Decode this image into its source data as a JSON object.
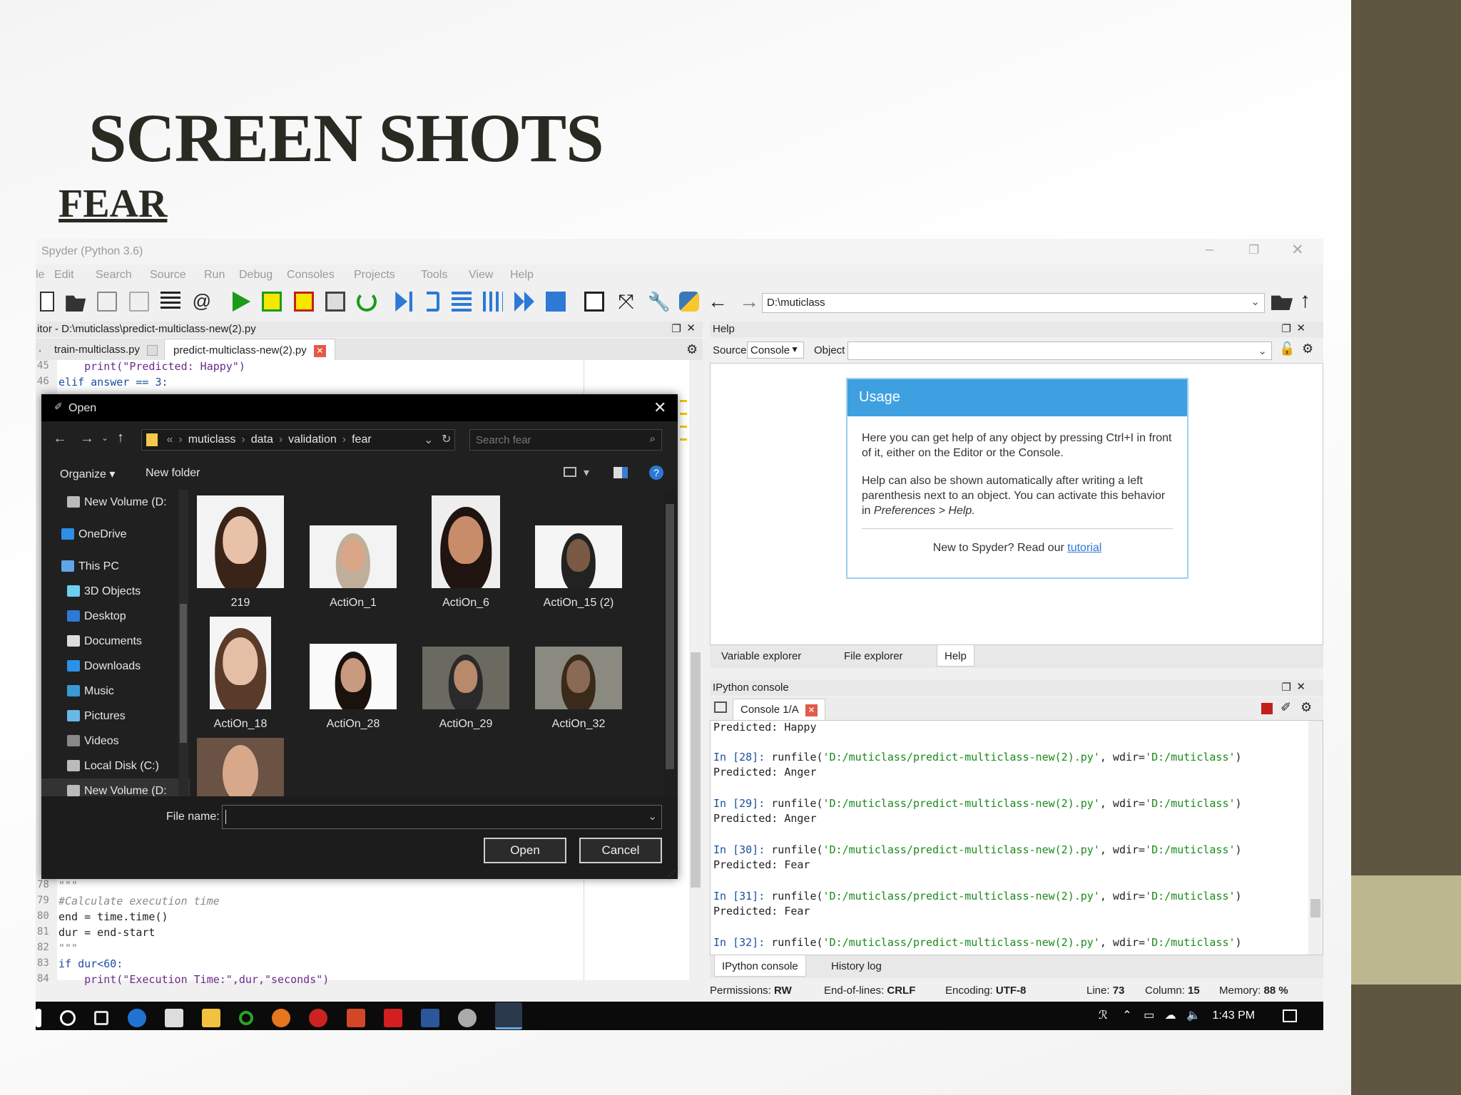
{
  "slide": {
    "title": "SCREEN SHOTS",
    "subtitle": "FEAR"
  },
  "window": {
    "title": "Spyder (Python 3.6)"
  },
  "menu": [
    "le",
    "Edit",
    "Search",
    "Source",
    "Run",
    "Debug",
    "Consoles",
    "Projects",
    "Tools",
    "View",
    "Help"
  ],
  "toolbar": {
    "path_value": "D:\\muticlass"
  },
  "editor": {
    "pane_title": "itor - D:\\muticlass\\predict-multiclass-new(2).py",
    "tabs": [
      "train-multiclass.py",
      "predict-multiclass-new(2).py"
    ],
    "lines_top": [
      {
        "n": "45",
        "code": "    print(\"Predicted: Happy\")"
      },
      {
        "n": "46",
        "code": "elif answer == 3:"
      }
    ],
    "lines_bottom": [
      {
        "n": "78",
        "code": "\"\"\""
      },
      {
        "n": "79",
        "code": "#Calculate execution time"
      },
      {
        "n": "80",
        "code": "end = time.time()"
      },
      {
        "n": "81",
        "code": "dur = end-start"
      },
      {
        "n": "82",
        "code": "\"\"\""
      },
      {
        "n": "83",
        "code": "if dur<60:"
      },
      {
        "n": "84",
        "code": "    print(\"Execution Time:\",dur,\"seconds\")"
      }
    ]
  },
  "dialog": {
    "title": "Open",
    "breadcrumb": [
      "«",
      "muticlass",
      "data",
      "validation",
      "fear"
    ],
    "search_placeholder": "Search fear",
    "organize": "Organize",
    "new_folder": "New folder",
    "sidebar": [
      "New Volume (D:",
      "OneDrive",
      "This PC",
      "3D Objects",
      "Desktop",
      "Documents",
      "Downloads",
      "Music",
      "Pictures",
      "Videos",
      "Local Disk (C:)",
      "New Volume (D:"
    ],
    "files": [
      "219",
      "ActiOn_1",
      "ActiOn_6",
      "ActiOn_15 (2)",
      "ActiOn_18",
      "ActiOn_28",
      "ActiOn_29",
      "ActiOn_32"
    ],
    "filename_label": "File name:",
    "filename_value": "",
    "open_label": "Open",
    "cancel_label": "Cancel"
  },
  "help": {
    "pane_title": "Help",
    "source_label": "Source",
    "source_value": "Console",
    "object_label": "Object",
    "usage_title": "Usage",
    "para1": "Here you can get help of any object by pressing Ctrl+I in front of it, either on the Editor or the Console.",
    "para2_a": "Help can also be shown automatically after writing a left parenthesis next to an object. You can activate this behavior in ",
    "para2_em": "Preferences > Help.",
    "new_prefix": "New to Spyder? Read our ",
    "new_link": "tutorial",
    "bottom_tabs": [
      "Variable explorer",
      "File explorer",
      "Help"
    ]
  },
  "console": {
    "pane_title": "IPython console",
    "tab": "Console 1/A",
    "first_line": "Predicted: Happy",
    "runs": [
      {
        "prompt": "In [28]: ",
        "result": "Predicted: Anger"
      },
      {
        "prompt": "In [29]: ",
        "result": "Predicted: Anger"
      },
      {
        "prompt": "In [30]: ",
        "result": "Predicted: Fear"
      },
      {
        "prompt": "In [31]: ",
        "result": "Predicted: Fear"
      },
      {
        "prompt": "In [32]: ",
        "result": ""
      }
    ],
    "cmd_a": "runfile(",
    "cmd_file": "'D:/muticlass/predict-multiclass-new(2).py'",
    "cmd_b": ", wdir=",
    "cmd_dir": "'D:/muticlass'",
    "cmd_c": ")",
    "bottom_tabs": [
      "IPython console",
      "History log"
    ]
  },
  "status": {
    "permissions_label": "Permissions:",
    "permissions": "RW",
    "eol_label": "End-of-lines:",
    "eol": "CRLF",
    "encoding_label": "Encoding:",
    "encoding": "UTF-8",
    "line_label": "Line:",
    "line": "73",
    "column_label": "Column:",
    "column": "15",
    "memory_label": "Memory:",
    "memory": "88 %"
  },
  "taskbar": {
    "time": "1:43 PM"
  },
  "colors": {
    "usage_blue": "#3ea0e0",
    "accent_green": "#1a9b1a",
    "bg_dark": "#202020",
    "slide_bar": "#5e5640",
    "slide_block": "#bdb78f"
  }
}
